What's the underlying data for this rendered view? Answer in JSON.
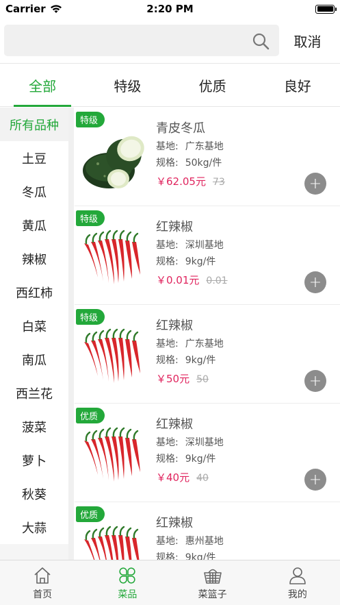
{
  "status_bar": {
    "carrier": "Carrier",
    "time": "2:20 PM"
  },
  "search": {
    "value": "",
    "placeholder": "",
    "cancel_label": "取消"
  },
  "grade_tabs": [
    "全部",
    "特级",
    "优质",
    "良好"
  ],
  "categories": [
    "所有品种",
    "土豆",
    "冬瓜",
    "黄瓜",
    "辣椒",
    "西红柿",
    "白菜",
    "南瓜",
    "西兰花",
    "菠菜",
    "萝卜",
    "秋葵",
    "大蒜"
  ],
  "labels": {
    "origin": "基地:",
    "spec": "规格:"
  },
  "products": [
    {
      "grade": "特级",
      "name": "青皮冬瓜",
      "origin": "广东基地",
      "spec": "50kg/件",
      "price": "￥62.05元",
      "old_price": "73",
      "image": "winter-melon"
    },
    {
      "grade": "特级",
      "name": "红辣椒",
      "origin": "深圳基地",
      "spec": "9kg/件",
      "price": "￥0.01元",
      "old_price": "0.01",
      "image": "red-pepper"
    },
    {
      "grade": "特级",
      "name": "红辣椒",
      "origin": "广东基地",
      "spec": "9kg/件",
      "price": "￥50元",
      "old_price": "50",
      "image": "red-pepper"
    },
    {
      "grade": "优质",
      "name": "红辣椒",
      "origin": "深圳基地",
      "spec": "9kg/件",
      "price": "￥40元",
      "old_price": "40",
      "image": "red-pepper"
    },
    {
      "grade": "优质",
      "name": "红辣椒",
      "origin": "惠州基地",
      "spec": "9kg/件",
      "price": "",
      "old_price": "",
      "image": "red-pepper"
    }
  ],
  "bottom_nav": [
    {
      "label": "首页",
      "icon": "home-icon"
    },
    {
      "label": "菜品",
      "icon": "clover-icon"
    },
    {
      "label": "菜篮子",
      "icon": "basket-icon"
    },
    {
      "label": "我的",
      "icon": "user-icon"
    }
  ],
  "colors": {
    "accent": "#23a83a",
    "price": "#e0245e"
  }
}
